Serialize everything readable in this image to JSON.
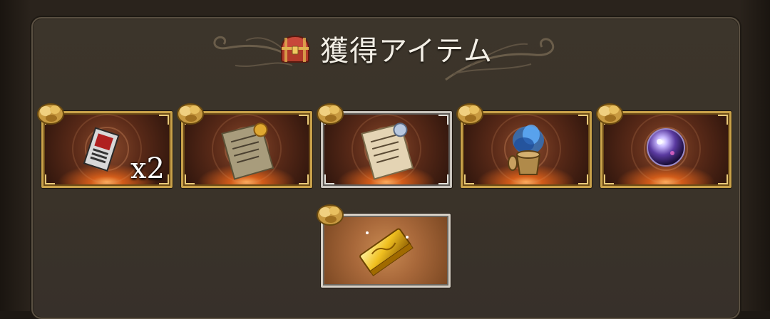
{
  "header": {
    "title": "獲得アイテム",
    "icon": "treasure-chest-icon"
  },
  "rewards": [
    {
      "item": "ticket-icon",
      "quantity": "x2",
      "frame": "gold"
    },
    {
      "item": "scroll-gold-seal-icon",
      "quantity": "",
      "frame": "gold"
    },
    {
      "item": "scroll-silver-seal-icon",
      "quantity": "",
      "frame": "silver"
    },
    {
      "item": "blue-flame-urn-icon",
      "quantity": "",
      "frame": "gold"
    },
    {
      "item": "crystal-orb-icon",
      "quantity": "",
      "frame": "gold"
    },
    {
      "item": "gold-bar-icon",
      "quantity": "",
      "frame": "silver"
    }
  ],
  "badge_icon": "gold-ore-badge-icon",
  "colors": {
    "panel_bg": "#3a3329",
    "gold_frame": "#c9a24a",
    "silver_frame": "#c9c4bd",
    "title_text": "#f3efe6"
  }
}
